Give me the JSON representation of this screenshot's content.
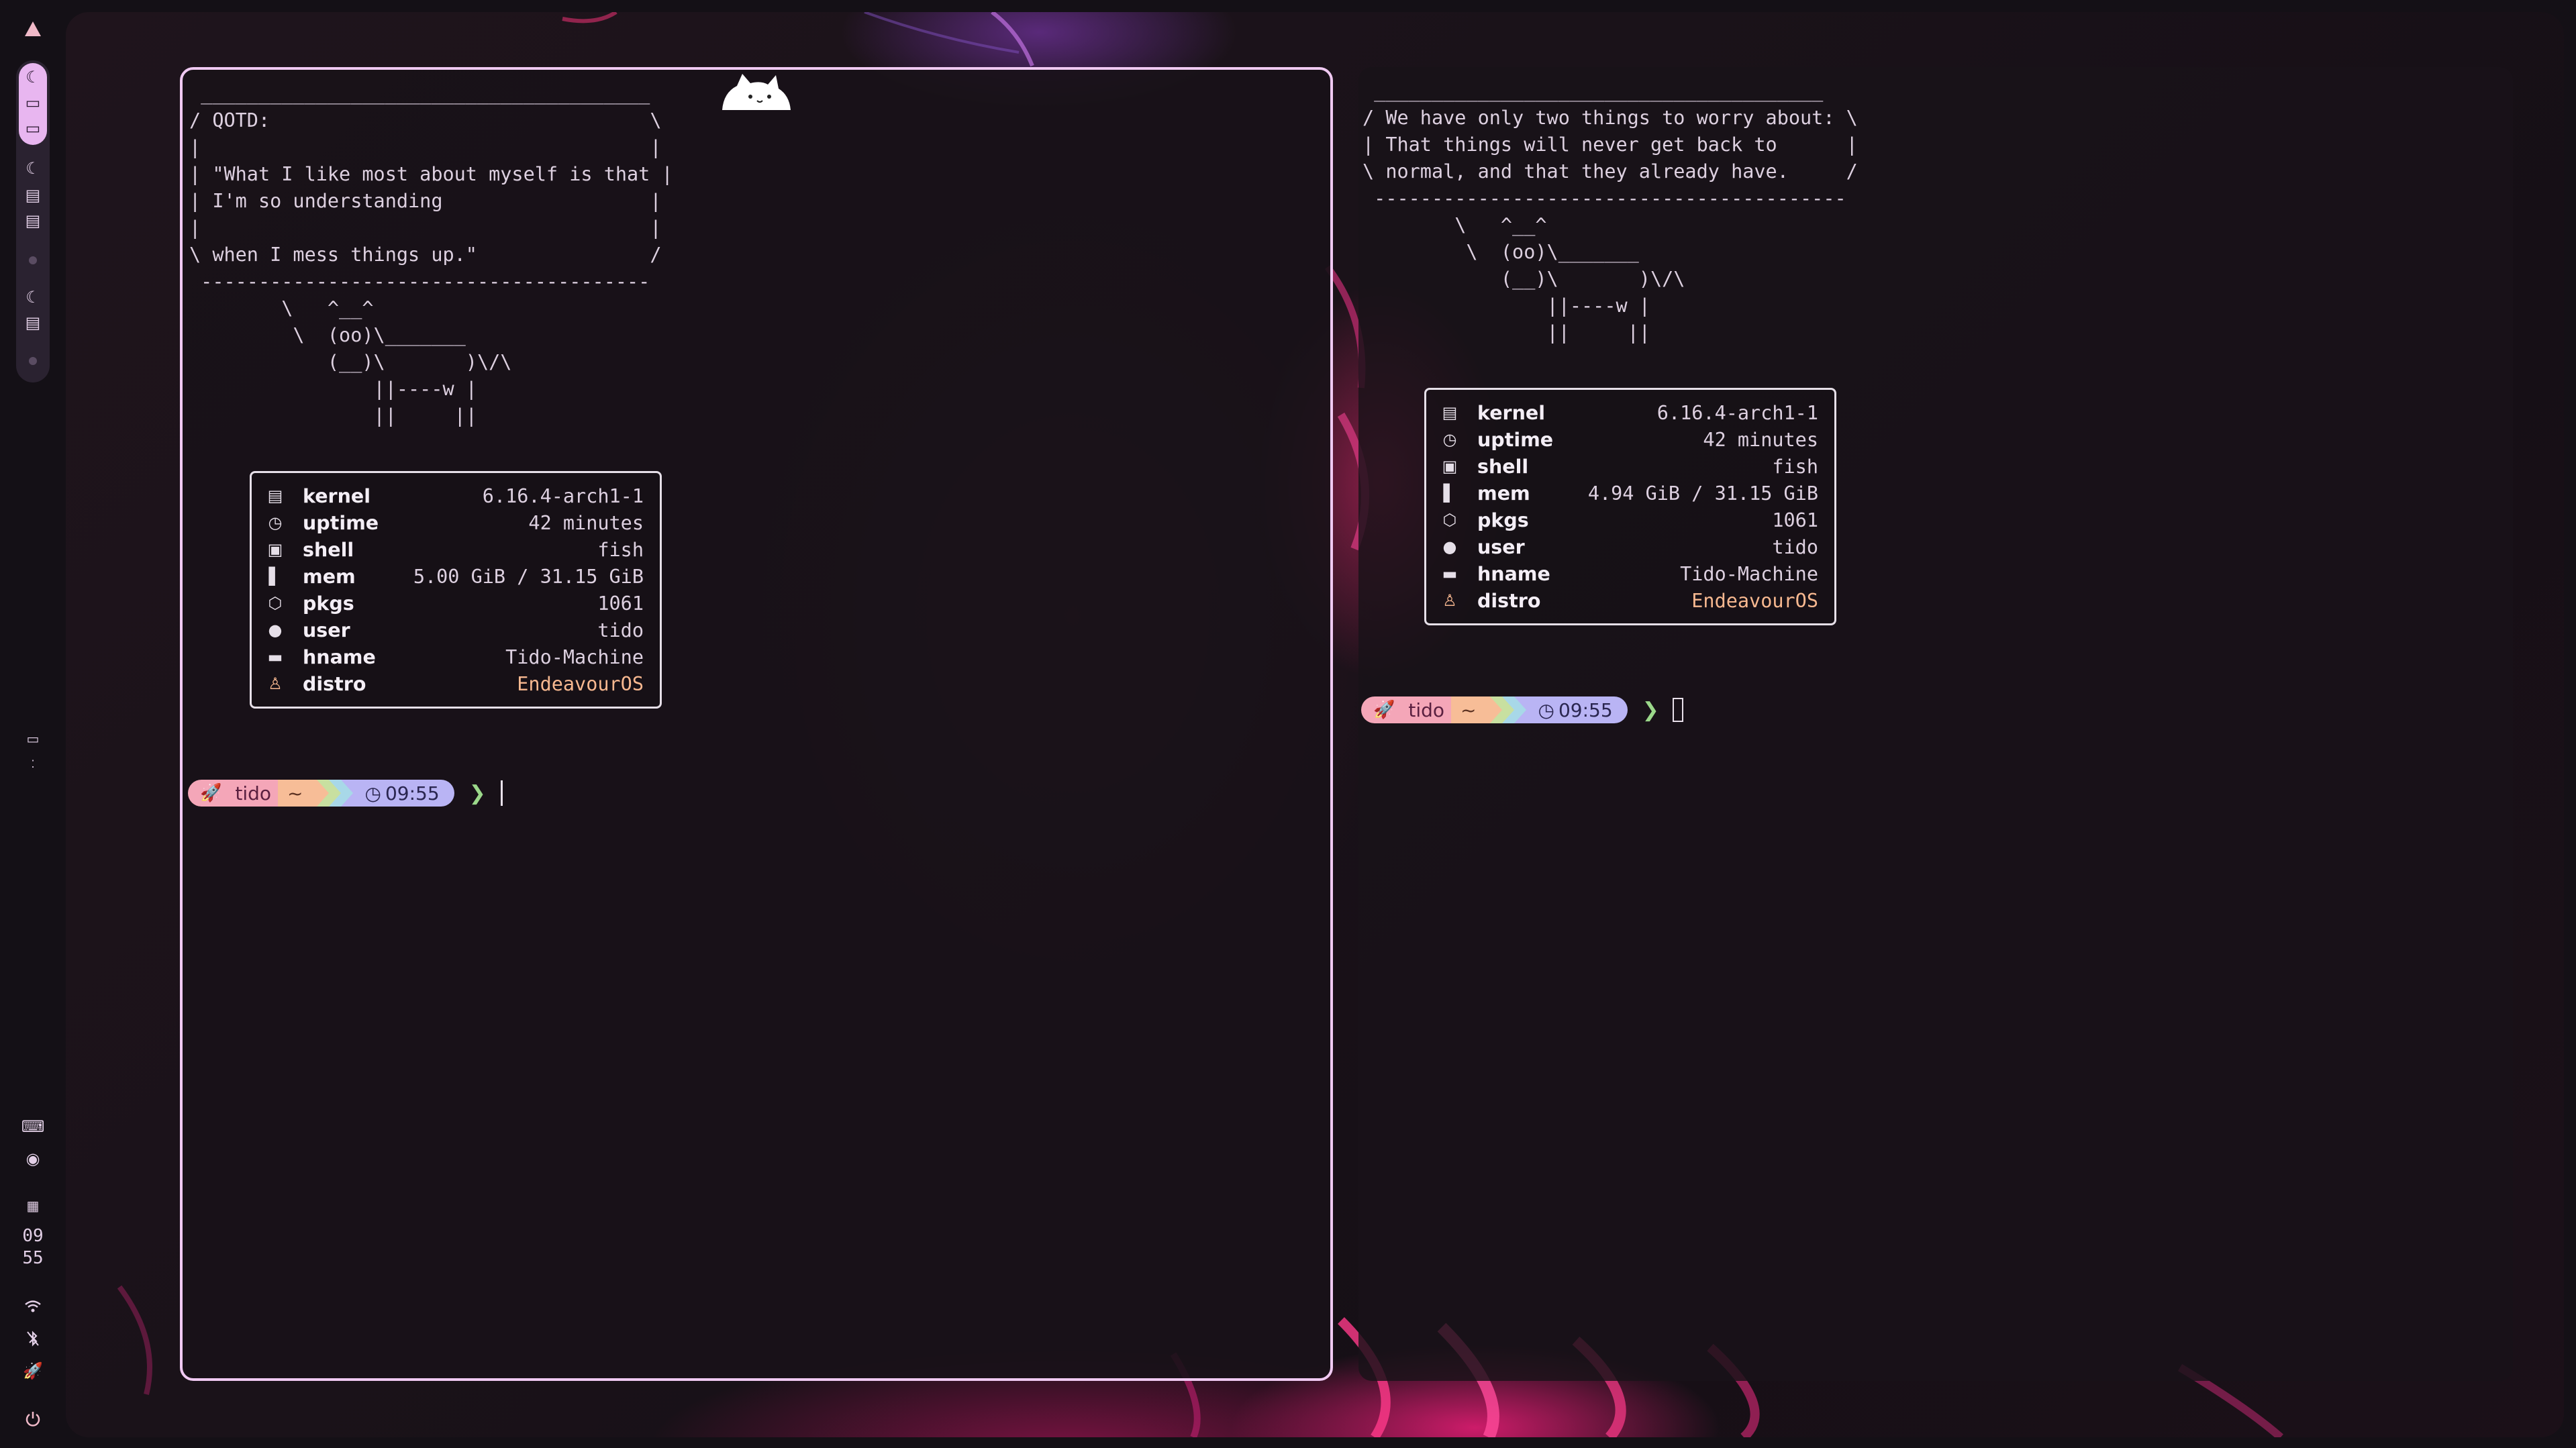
{
  "sidebar": {
    "top_icon": "arch-triangle-icon",
    "clock": {
      "hour": "09",
      "minute": "55"
    }
  },
  "colors": {
    "accent_border": "#f0c9f2",
    "prompt_user_bg": "#f4a6b8",
    "prompt_dir_bg": "#f7bd97",
    "prompt_time_bg": "#b9b4f4",
    "prompt_caret": "#9bd88a",
    "distro_value": "#f7b890"
  },
  "left_terminal": {
    "cowsay": " _______________________________________\n/ QOTD:                                 \\\n|                                       |\n| \"What I like most about myself is that |\n| I'm so understanding                  |\n|                                       |\n\\ when I mess things up.\"               /\n ---------------------------------------\n        \\   ^__^\n         \\  (oo)\\_______\n            (__)\\       )\\/\\\n                ||----w |\n                ||     ||",
    "info": [
      {
        "icon": "cpu-icon",
        "key": "kernel",
        "value": "6.16.4-arch1-1"
      },
      {
        "icon": "clock-icon",
        "key": "uptime",
        "value": "42 minutes"
      },
      {
        "icon": "terminal-icon",
        "key": "shell",
        "value": "fish"
      },
      {
        "icon": "memory-icon",
        "key": "mem",
        "value": "5.00 GiB / 31.15 GiB"
      },
      {
        "icon": "package-icon",
        "key": "pkgs",
        "value": "1061"
      },
      {
        "icon": "user-icon",
        "key": "user",
        "value": "tido"
      },
      {
        "icon": "monitor-icon",
        "key": "hname",
        "value": "Tido-Machine"
      },
      {
        "icon": "linux-icon",
        "key": "distro",
        "value": "EndeavourOS"
      }
    ],
    "prompt": {
      "user": "tido",
      "dir": "~",
      "time": "09:55",
      "caret": "❯"
    }
  },
  "right_terminal": {
    "cowsay": " _______________________________________\n/ We have only two things to worry about: \\\n| That things will never get back to      |\n\\ normal, and that they already have.     /\n -----------------------------------------\n        \\   ^__^\n         \\  (oo)\\_______\n            (__)\\       )\\/\\\n                ||----w |\n                ||     ||",
    "info": [
      {
        "icon": "cpu-icon",
        "key": "kernel",
        "value": "6.16.4-arch1-1"
      },
      {
        "icon": "clock-icon",
        "key": "uptime",
        "value": "42 minutes"
      },
      {
        "icon": "terminal-icon",
        "key": "shell",
        "value": "fish"
      },
      {
        "icon": "memory-icon",
        "key": "mem",
        "value": "4.94 GiB / 31.15 GiB"
      },
      {
        "icon": "package-icon",
        "key": "pkgs",
        "value": "1061"
      },
      {
        "icon": "user-icon",
        "key": "user",
        "value": "tido"
      },
      {
        "icon": "monitor-icon",
        "key": "hname",
        "value": "Tido-Machine"
      },
      {
        "icon": "linux-icon",
        "key": "distro",
        "value": "EndeavourOS"
      }
    ],
    "prompt": {
      "user": "tido",
      "dir": "~",
      "time": "09:55",
      "caret": "❯"
    }
  }
}
